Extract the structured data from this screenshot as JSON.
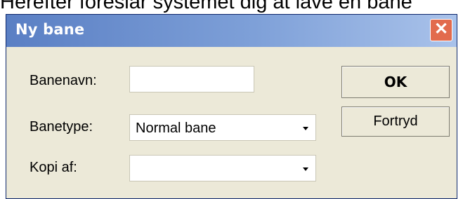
{
  "background_caption": "Herefter foreslår systemet dig at lave en bane",
  "dialog": {
    "title": "Ny bane",
    "close_symbol": "✕",
    "fields": {
      "banenavn": {
        "label": "Banenavn:",
        "value": ""
      },
      "banetype": {
        "label": "Banetype:",
        "value": "Normal bane"
      },
      "kopi_af": {
        "label": "Kopi af:",
        "value": ""
      }
    },
    "buttons": {
      "ok": "OK",
      "cancel": "Fortryd"
    }
  },
  "icons": {
    "close": "close-icon",
    "dropdown": "chevron-down-icon"
  }
}
